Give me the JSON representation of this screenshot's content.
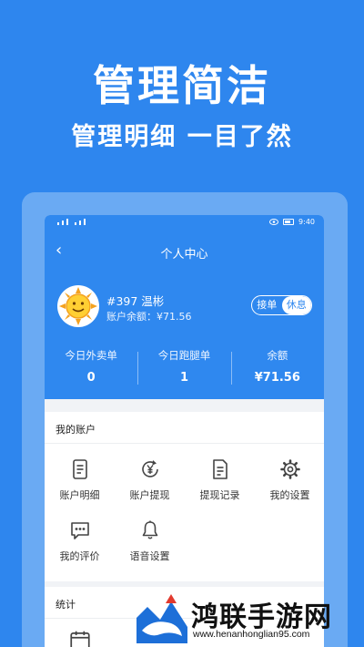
{
  "promo": {
    "headline": "管理简洁",
    "subline": "管理明细 一目了然"
  },
  "status_bar": {
    "time": "9:40",
    "battery": "battery-icon",
    "eye": "eye-icon"
  },
  "nav": {
    "back_icon": "chevron-left-icon",
    "title": "个人中心"
  },
  "profile": {
    "name": "#397 温彬",
    "balance_text": "账户余额：¥71.56",
    "status_toggle": {
      "on_label": "接单",
      "off_label": "休息",
      "selected": "休息"
    }
  },
  "stats": [
    {
      "label": "今日外卖单",
      "value": "0"
    },
    {
      "label": "今日跑腿单",
      "value": "1"
    },
    {
      "label": "余额",
      "value": "¥71.56"
    }
  ],
  "account_section": {
    "title": "我的账户",
    "items": [
      {
        "label": "账户明细",
        "icon": "document-lines-icon"
      },
      {
        "label": "账户提现",
        "icon": "yen-refresh-icon"
      },
      {
        "label": "提现记录",
        "icon": "document-list-icon"
      },
      {
        "label": "我的设置",
        "icon": "gear-icon"
      },
      {
        "label": "我的评价",
        "icon": "chat-bubble-icon"
      },
      {
        "label": "语音设置",
        "icon": "bell-icon"
      }
    ]
  },
  "stats_section": {
    "title": "统计",
    "items": [
      {
        "icon": "calendar-icon"
      }
    ]
  },
  "watermark": {
    "text": "鸿联手游网",
    "url": "www.henanhonglian95.com"
  },
  "colors": {
    "background": "#2e86ee",
    "header_blue": "#2f88ef",
    "frame": "#6aaaf3"
  }
}
